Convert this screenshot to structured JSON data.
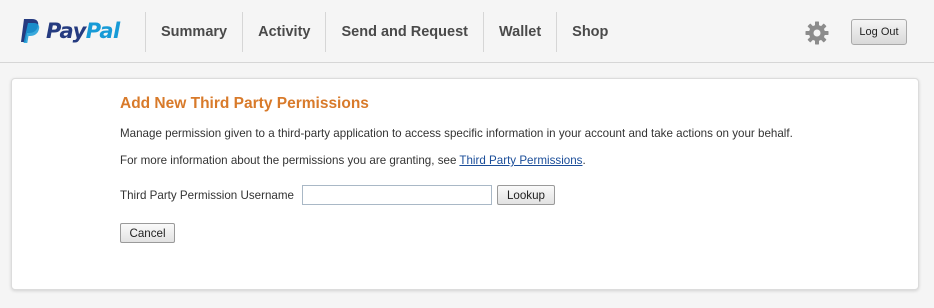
{
  "header": {
    "logo": {
      "pay": "Pay",
      "pal": "Pal"
    },
    "nav": [
      {
        "label": "Summary"
      },
      {
        "label": "Activity"
      },
      {
        "label": "Send and Request"
      },
      {
        "label": "Wallet"
      },
      {
        "label": "Shop"
      }
    ],
    "settings_icon": "gear-icon",
    "logout_label": "Log Out"
  },
  "main": {
    "title": "Add New Third Party Permissions",
    "description": "Manage permission given to a third-party application to access specific information in your account and take actions on your behalf.",
    "info_prefix": "For more information about the permissions you are granting, see ",
    "info_link": "Third Party Permissions",
    "info_suffix": ".",
    "username_label": "Third Party Permission Username",
    "username_value": "",
    "lookup_label": "Lookup",
    "cancel_label": "Cancel"
  },
  "colors": {
    "brand_dark": "#253b80",
    "brand_light": "#179bd7",
    "title": "#d87a2a",
    "link": "#1a4d99"
  }
}
